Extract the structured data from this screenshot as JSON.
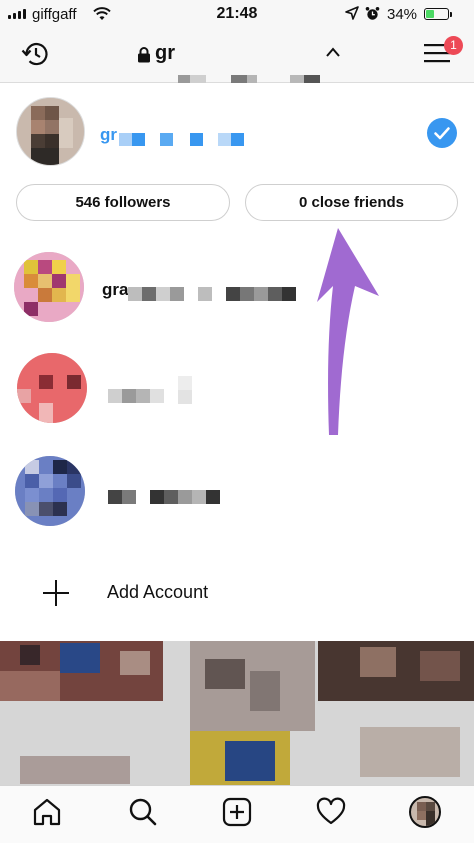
{
  "status_bar": {
    "carrier": "giffgaff",
    "time": "21:48",
    "battery_percent": "34%",
    "battery_level": 0.34,
    "icons": [
      "signal-bars-icon",
      "wifi-icon",
      "location-arrow-icon",
      "alarm-clock-icon",
      "battery-icon"
    ]
  },
  "nav": {
    "username_visible": "gr",
    "history_icon": "history-icon",
    "lock_icon": "lock-icon",
    "caret_icon": "caret-up-icon",
    "menu_icon": "hamburger-menu-icon",
    "notification_count": "1"
  },
  "accounts": {
    "current": {
      "name_visible": "gr",
      "selected": true,
      "followers_button": "546 followers",
      "close_friends_button": "0 close friends"
    },
    "others": [
      {
        "name_visible": "gra"
      },
      {
        "name_visible": ""
      },
      {
        "name_visible": ""
      }
    ],
    "add_account_label": "Add Account"
  },
  "tab_bar": {
    "tabs": [
      "home-icon",
      "search-icon",
      "new-post-icon",
      "activity-heart-icon",
      "profile-avatar"
    ]
  },
  "colors": {
    "accent_blue": "#3897f0",
    "badge_red": "#ed4956",
    "annotation_purple": "#a06ad1",
    "battery_green": "#4cd964"
  }
}
